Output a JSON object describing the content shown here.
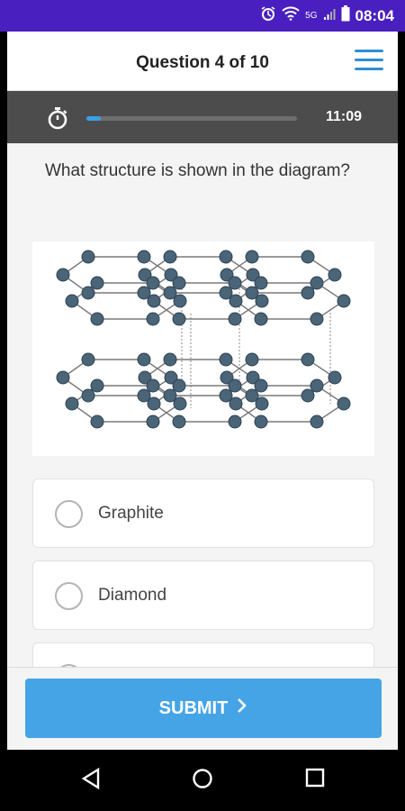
{
  "status_bar": {
    "network": "5G",
    "time": "08:04"
  },
  "header": {
    "title": "Question 4 of 10",
    "menu_icon": "hamburger-menu-icon"
  },
  "timer": {
    "icon": "stopwatch-icon",
    "remaining": "11:09",
    "progress": 0.07
  },
  "question": {
    "text": "What structure is shown in the diagram?"
  },
  "diagram": {
    "subject": "layered hexagonal lattice"
  },
  "options": [
    {
      "label": "Graphite"
    },
    {
      "label": "Diamond"
    },
    {
      "label": ""
    }
  ],
  "submit": {
    "label": "SUBMIT",
    "icon": "chevron-right-icon"
  },
  "colors": {
    "status_bar": "#4a1fbf",
    "accent": "#2d8fd6",
    "submit": "#45a4e6",
    "timer_bar": "#4c4c4c",
    "atom": "#4a6478"
  },
  "navbar": {
    "back_icon": "back-triangle-icon",
    "home_icon": "home-circle-icon",
    "recents_icon": "recents-square-icon"
  }
}
